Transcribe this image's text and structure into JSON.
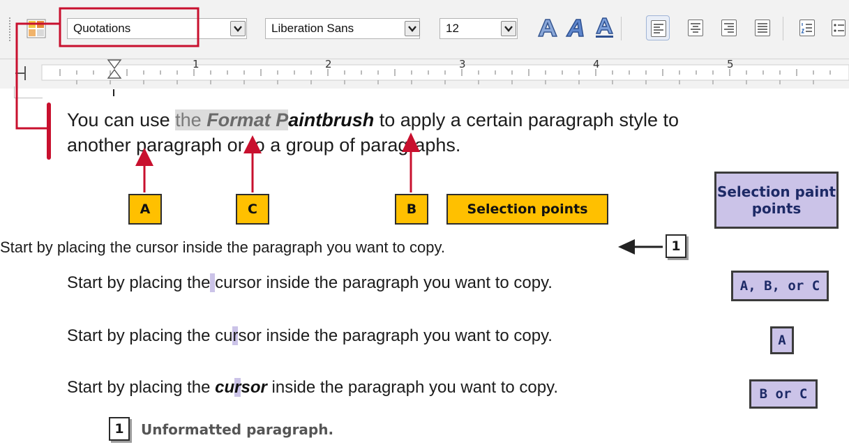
{
  "toolbar": {
    "style_value": "Quotations",
    "font_value": "Liberation Sans",
    "size_value": "12",
    "icons": [
      "styles-icon",
      "fontwork-shadow-icon",
      "fontwork-italic-icon",
      "fontwork-underline-icon",
      "align-left-icon",
      "align-center-icon",
      "align-right-icon",
      "justify-icon",
      "numbered-list-icon",
      "bullet-list-icon"
    ]
  },
  "ruler": {
    "marks": [
      "1",
      "2",
      "3",
      "4",
      "5"
    ]
  },
  "sample": {
    "line1_a": "You can use ",
    "line1_sel_plain": "the ",
    "line1_sel_bold": "Format P",
    "line1_bold": "aintbrush",
    "line1_b": " to apply a certain paragraph style to",
    "line2": "another paragraph or to a group of paragraphs."
  },
  "callouts": {
    "a": "A",
    "c": "C",
    "b": "B",
    "selection_points": "Selection points",
    "selection_paint_points": "Selection paint points"
  },
  "lines": {
    "original": "Start by placing the cursor inside the paragraph you want to copy.",
    "row1_before": "Start by placing the",
    "row1_hl": " ",
    "row1_after": "cursor inside the paragraph you want to copy.",
    "row2_before": "Start by placing the cu",
    "row2_hl": "r",
    "row2_after": "sor inside the paragraph you want to copy.",
    "row3_before": "Start by placing the ",
    "row3_b1": "cu",
    "row3_hl": "r",
    "row3_b2": "sor",
    "row3_after": " inside the paragraph you want to copy."
  },
  "badges": {
    "one": "1",
    "row1": "A, B, or C",
    "row2": "A",
    "row3": "B or C"
  },
  "footer": {
    "number": "1",
    "label": "Unformatted paragraph."
  },
  "colors": {
    "arrow_red": "#c8102e",
    "callout_yellow": "#ffc000",
    "callout_purple": "#cbc3e8",
    "highlight": "#cbc3e8"
  }
}
